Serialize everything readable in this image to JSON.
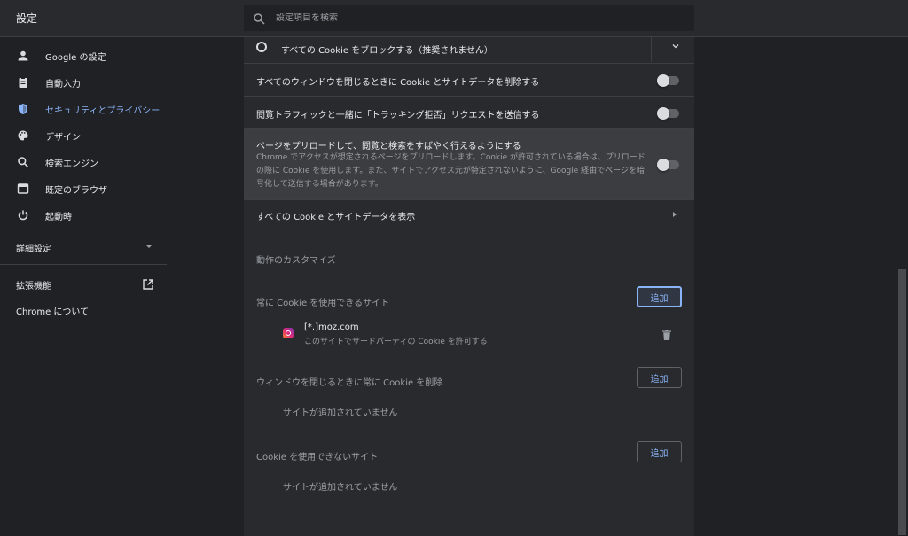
{
  "header": {
    "title": "設定",
    "search_placeholder": "設定項目を検索"
  },
  "sidebar": {
    "items": [
      {
        "label": "Google の設定",
        "icon": "person-icon"
      },
      {
        "label": "自動入力",
        "icon": "clipboard-icon"
      },
      {
        "label": "セキュリティとプライバシー",
        "icon": "shield-icon",
        "active": true
      },
      {
        "label": "デザイン",
        "icon": "palette-icon"
      },
      {
        "label": "検索エンジン",
        "icon": "search-icon"
      },
      {
        "label": "既定のブラウザ",
        "icon": "browser-icon"
      },
      {
        "label": "起動時",
        "icon": "power-icon"
      }
    ],
    "advanced": "詳細設定",
    "extensions": "拡張機能",
    "about": "Chrome について"
  },
  "main": {
    "block_all_cookies": "すべての Cookie をブロックする（推奨されません）",
    "clear_on_close": "すべてのウィンドウを閉じるときに Cookie とサイトデータを削除する",
    "do_not_track": "閲覧トラフィックと一緒に「トラッキング拒否」リクエストを送信する",
    "preload": {
      "title": "ページをプリロードして、閲覧と検索をすばやく行えるようにする",
      "description": "Chrome でアクセスが想定されるページをプリロードします。Cookie が許可されている場合は、プリロードの際に Cookie を使用します。また、サイトでアクセス元が特定されないように、Google 経由でページを暗号化して送信する場合があります。"
    },
    "see_all_cookies": "すべての Cookie とサイトデータを表示",
    "customized_behaviors": "動作のカスタマイズ",
    "always_allow": {
      "label": "常に Cookie を使用できるサイト",
      "add": "追加",
      "site": {
        "name": "[*.]moz.com",
        "detail": "このサイトでサードパーティの Cookie を許可する"
      }
    },
    "clear_on_exit": {
      "label": "ウィンドウを閉じるときに常に Cookie を削除",
      "add": "追加",
      "empty": "サイトが追加されていません"
    },
    "never_allow": {
      "label": "Cookie を使用できないサイト",
      "add": "追加",
      "empty": "サイトが追加されていません"
    }
  },
  "colors": {
    "accent": "#8ab4f8",
    "background": "#202124",
    "card": "#292a2d"
  }
}
